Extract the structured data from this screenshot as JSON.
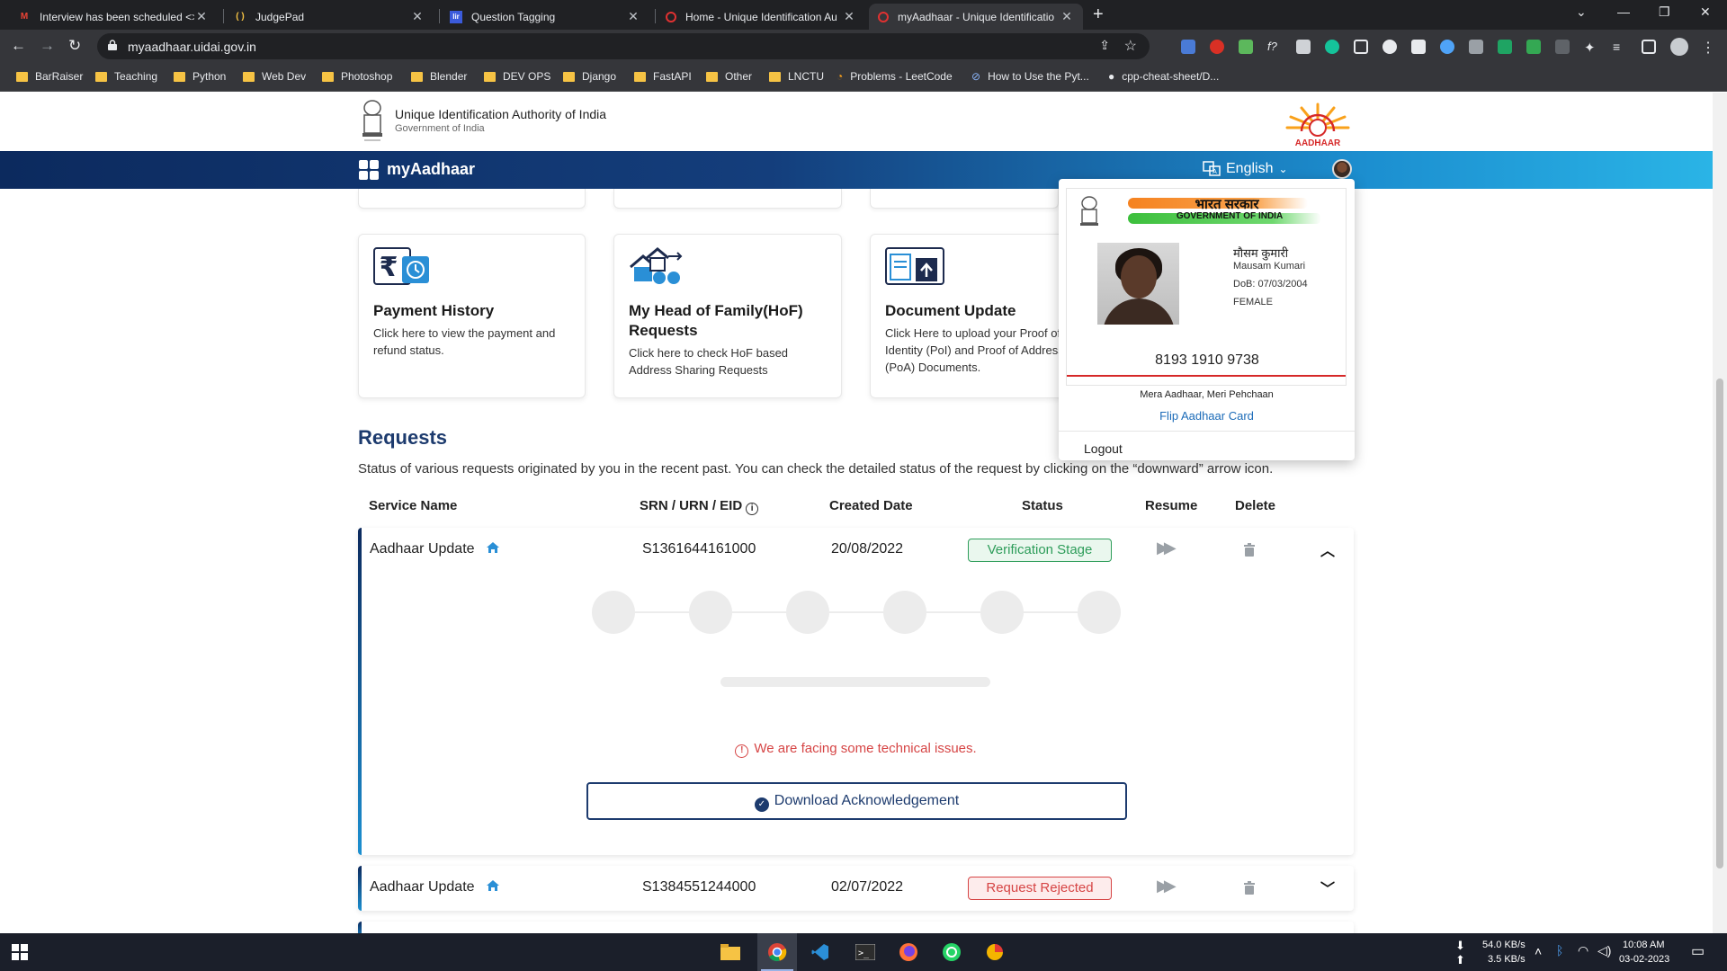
{
  "browser": {
    "tabs": [
      {
        "title": "Interview has been scheduled <>",
        "icon": "gmail-icon"
      },
      {
        "title": "JudgePad",
        "icon": "judgepad-icon"
      },
      {
        "title": "Question Tagging",
        "icon": "tagging-icon"
      },
      {
        "title": "Home - Unique Identification Au",
        "icon": "uidai-icon"
      },
      {
        "title": "myAadhaar - Unique Identificatio",
        "icon": "uidai-icon"
      }
    ],
    "url": "myaadhaar.uidai.gov.in",
    "bookmarks": [
      {
        "label": "BarRaiser",
        "type": "folder"
      },
      {
        "label": "Teaching",
        "type": "folder"
      },
      {
        "label": "Python",
        "type": "folder"
      },
      {
        "label": "Web Dev",
        "type": "folder"
      },
      {
        "label": "Photoshop",
        "type": "folder"
      },
      {
        "label": "Blender",
        "type": "folder"
      },
      {
        "label": "DEV OPS",
        "type": "folder"
      },
      {
        "label": "Django",
        "type": "folder"
      },
      {
        "label": "FastAPI",
        "type": "folder"
      },
      {
        "label": "Other",
        "type": "folder"
      },
      {
        "label": "LNCTU",
        "type": "folder"
      },
      {
        "label": "Problems - LeetCode",
        "type": "link"
      },
      {
        "label": "How to Use the Pyt...",
        "type": "link"
      },
      {
        "label": "cpp-cheat-sheet/D...",
        "type": "link"
      }
    ]
  },
  "header": {
    "org_name": "Unique Identification Authority of India",
    "org_sub": "Government of India",
    "logo_text": "AADHAAR"
  },
  "navbar": {
    "title": "myAadhaar",
    "language": "English"
  },
  "services": [
    {
      "title": "Payment History",
      "desc": "Click here to view the payment and refund status."
    },
    {
      "title": "My Head of Family(HoF) Requests",
      "desc": "Click here to check HoF based Address Sharing Requests"
    },
    {
      "title": "Document Update",
      "desc": "Click Here to upload your Proof of Identity (PoI) and Proof of Address (PoA) Documents."
    }
  ],
  "requests": {
    "title": "Requests",
    "description": "Status of various requests originated by you in the recent past. You can check the detailed status of the request by clicking on the “downward” arrow icon.",
    "columns": [
      "Service Name",
      "SRN / URN / EID",
      "Created Date",
      "Status",
      "Resume",
      "Delete"
    ],
    "rows": [
      {
        "service": "Aadhaar Update",
        "srn": "S1361644161000",
        "date": "20/08/2022",
        "status": "Verification Stage",
        "status_color": "#2e9d5a",
        "expanded": true
      },
      {
        "service": "Aadhaar Update",
        "srn": "S1384551244000",
        "date": "02/07/2022",
        "status": "Request Rejected",
        "status_color": "#d64545",
        "expanded": false
      }
    ],
    "error_message": "We are facing some technical issues.",
    "download_label": "Download Acknowledgement"
  },
  "profile_card": {
    "gov_hindi": "भारत सरकार",
    "gov_en": "GOVERNMENT OF INDIA",
    "name_hindi": "मौसम कुमारी",
    "name": "Mausam Kumari",
    "dob": "DoB: 07/03/2004",
    "gender": "FEMALE",
    "aadhaar_number": "8193 1910 9738",
    "tagline": "Mera Aadhaar, Meri Pehchaan",
    "flip_label": "Flip Aadhaar Card",
    "logout_label": "Logout"
  },
  "taskbar": {
    "net_down": "54.0 KB/s",
    "net_up": "3.5 KB/s",
    "time": "10:08 AM",
    "date": "03-02-2023"
  },
  "colors": {
    "primary": "#1d3b6e",
    "link": "#1b6bb8",
    "success": "#2e9d5a",
    "danger": "#d64545"
  }
}
